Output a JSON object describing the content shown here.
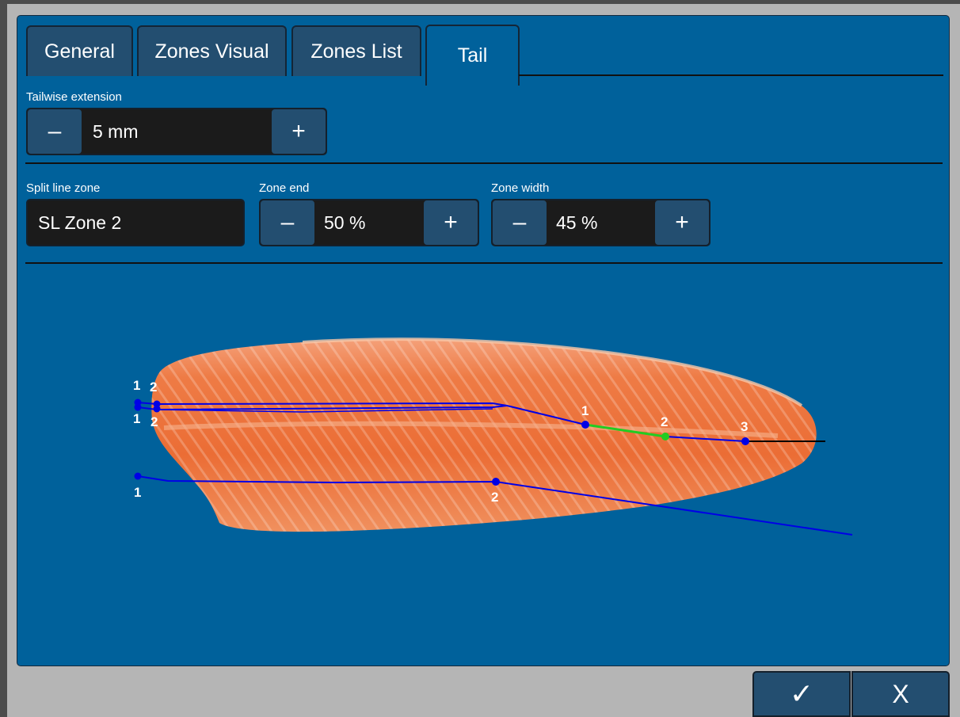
{
  "tabs": [
    {
      "label": "General"
    },
    {
      "label": "Zones Visual"
    },
    {
      "label": "Zones List"
    },
    {
      "label": "Tail",
      "active": true
    }
  ],
  "tailwise": {
    "label": "Tailwise extension",
    "value": "5 mm",
    "minus": "–",
    "plus": "+"
  },
  "split_line_zone": {
    "label": "Split line zone",
    "value": "SL Zone 2"
  },
  "zone_end": {
    "label": "Zone end",
    "value": "50 %",
    "minus": "–",
    "plus": "+"
  },
  "zone_width": {
    "label": "Zone width",
    "value": "45 %",
    "minus": "–",
    "plus": "+"
  },
  "points": {
    "upper_left_top": [
      "1",
      "2"
    ],
    "upper_left_bottom": [
      "1",
      "2"
    ],
    "upper_right": [
      "1",
      "2",
      "3"
    ],
    "lower": [
      "1",
      "2"
    ]
  },
  "footer": {
    "ok_icon": "checkmark-icon",
    "ok": "✓",
    "cancel_icon": "close-icon",
    "cancel": "X"
  },
  "colors": {
    "panel": "#00619b",
    "button": "#234e70",
    "field": "#1b1b1b",
    "split_line": "#0000e6",
    "active_segment": "#22cc22",
    "tail_line": "#000000"
  }
}
